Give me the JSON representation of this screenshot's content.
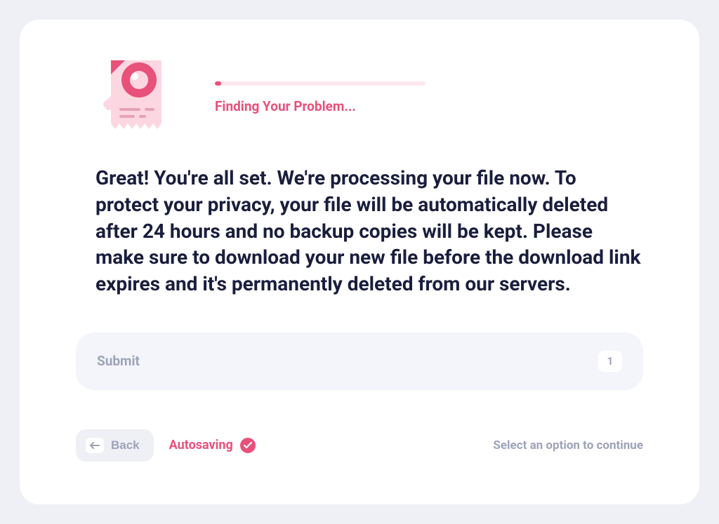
{
  "header": {
    "progress_label": "Finding Your Problem...",
    "progress_percent": 3
  },
  "main": {
    "message": "Great! You're all set. We're processing your file now. To protect your privacy, your file will be automatically deleted after 24 hours and no backup copies will be kept. Please make sure to download your new file before the download link expires and it's permanently deleted from our servers."
  },
  "submit": {
    "label": "Submit",
    "count": "1"
  },
  "footer": {
    "back_label": "Back",
    "autosaving_label": "Autosaving",
    "continue_hint": "Select an option to continue"
  },
  "colors": {
    "accent": "#e8517a",
    "text_dark": "#1a1e3d",
    "text_muted": "#9ea3b8",
    "bg_light": "#f4f5fb",
    "bg_page": "#eef0f5"
  }
}
